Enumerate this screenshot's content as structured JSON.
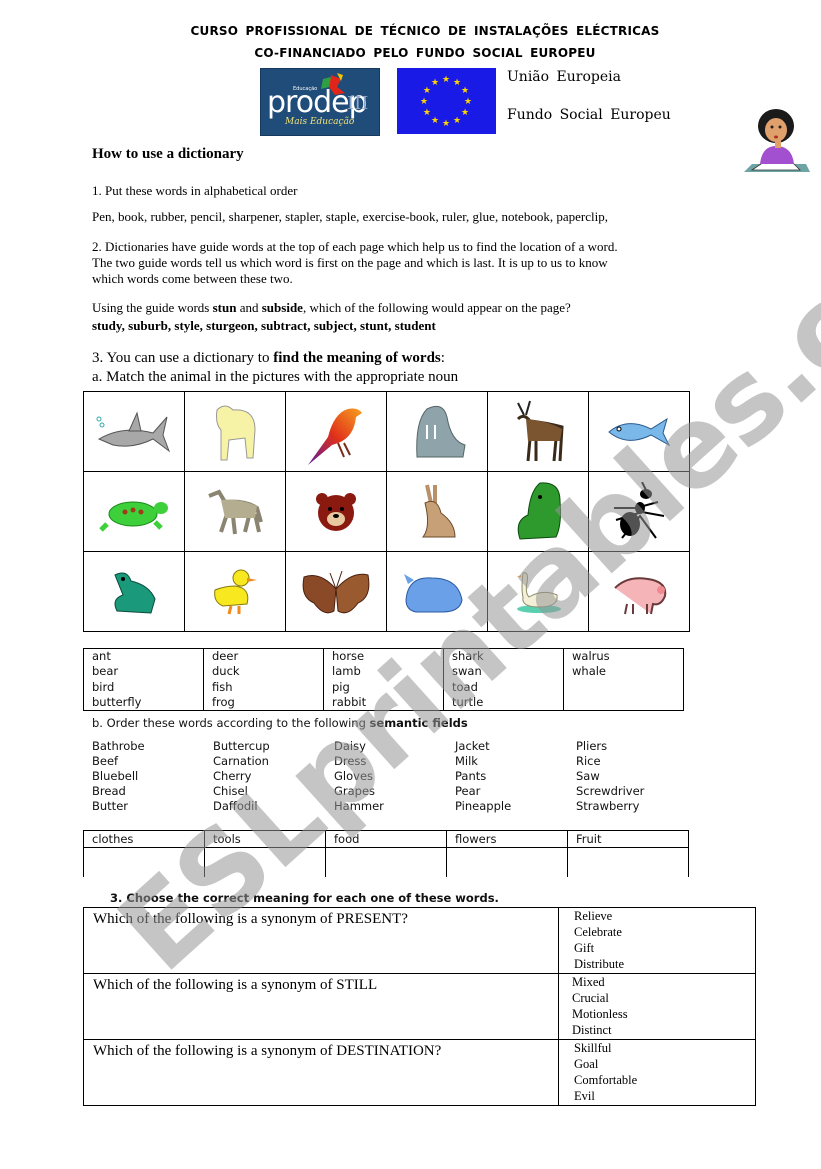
{
  "header": {
    "line1": "CURSO PROFISSIONAL DE TÉCNICO DE INSTALAÇÕES ELÉCTRICAS",
    "line2": "CO-FINANCIADO PELO FUNDO SOCIAL EUROPEU",
    "prodep_logo": {
      "small_text": "Educação",
      "name": "prodep",
      "suffix": "III",
      "tagline": "Mais Educação"
    },
    "eu_label_1": "União Europeia",
    "eu_label_2": "Fundo Social Europeu"
  },
  "title": "How to use a dictionary",
  "section1": {
    "instruction": "1. Put these words in alphabetical order",
    "words": "Pen, book, rubber, pencil, sharpener, stapler, staple, exercise-book, ruler, glue, notebook, paperclip,"
  },
  "section2": {
    "paragraph_lines": [
      "2. Dictionaries have guide words at the top of each page which help us to find the location of a word.",
      "The two guide words tell us which word is first on the page and which is last. It is up to us to know",
      "which words come between these two."
    ],
    "question_prefix": "Using the guide words ",
    "guide1": "stun",
    "and": " and ",
    "guide2": "subside",
    "question_suffix": ", which of the following would appear on the page?",
    "options": "study, suburb, style, sturgeon, subtract, subject, stunt, student"
  },
  "section3": {
    "intro_prefix": "3. You can use a dictionary to ",
    "intro_bold": "find the meaning of words",
    "intro_suffix": ":",
    "part_a": "a. Match the animal in the pictures with the appropriate noun",
    "pictures": [
      [
        "shark",
        "lamb",
        "bird",
        "walrus",
        "deer",
        "fish"
      ],
      [
        "turtle",
        "horse",
        "bear",
        "rabbit",
        "toad",
        "ant"
      ],
      [
        "frog",
        "duck",
        "butterfly",
        "whale",
        "swan",
        "pig"
      ]
    ],
    "word_columns": [
      [
        "ant",
        "bear",
        "bird",
        "butterfly"
      ],
      [
        "deer",
        "duck",
        "fish",
        "frog"
      ],
      [
        "horse",
        "lamb",
        "pig",
        "rabbit"
      ],
      [
        "shark",
        "swan",
        "toad",
        "turtle"
      ],
      [
        "walrus",
        "whale"
      ]
    ],
    "part_b_prefix": "b. Order these words according to the following ",
    "part_b_bold": "semantic fields",
    "field_words": [
      [
        "Bathrobe",
        "Beef",
        "Bluebell",
        "Bread",
        "Butter"
      ],
      [
        "Buttercup",
        "Carnation",
        "Cherry",
        "Chisel",
        "Daffodil"
      ],
      [
        "Daisy",
        "Dress",
        "Gloves",
        "Grapes",
        "Hammer"
      ],
      [
        "Jacket",
        "Milk",
        "Pants",
        "Pear",
        "Pineapple"
      ],
      [
        "Pliers",
        "Rice",
        "Saw",
        "Screwdriver",
        "Strawberry"
      ]
    ],
    "field_headers": [
      "clothes",
      "tools",
      "food",
      "flowers",
      "Fruit"
    ]
  },
  "quiz": {
    "title": "3. Choose the correct meaning for each one of these words.",
    "questions": [
      {
        "question": "Which of the following is a synonym of PRESENT?",
        "options": [
          "Relieve",
          "Celebrate",
          "Gift",
          "Distribute"
        ]
      },
      {
        "question": "Which of the following is a synonym of STILL",
        "options": [
          "Mixed",
          "Crucial",
          "Motionless",
          "Distinct"
        ]
      },
      {
        "question": "Which of the following is a synonym of DESTINATION?",
        "options": [
          "Skillful",
          "Goal",
          "Comfortable",
          "Evil"
        ]
      }
    ]
  },
  "watermark": "ESLprintables.com"
}
